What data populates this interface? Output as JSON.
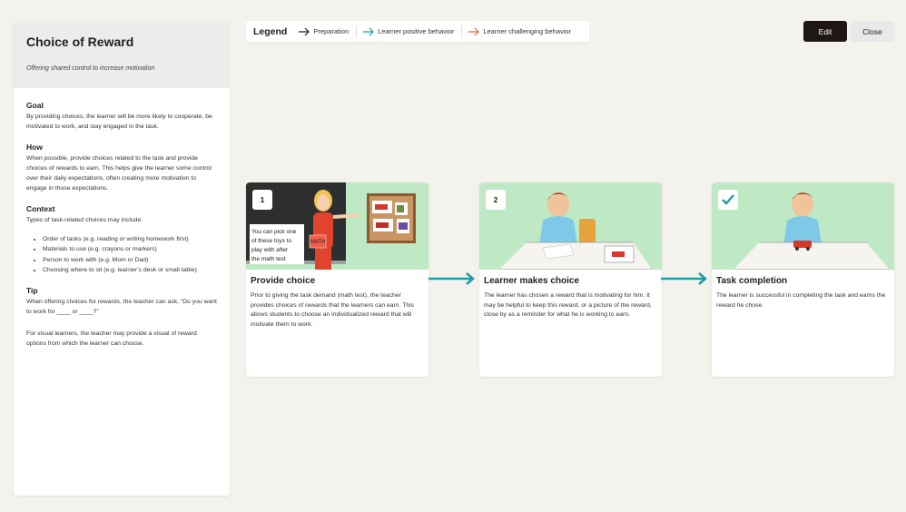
{
  "sidebar": {
    "title": "Choice of Reward",
    "subtitle": "Offering shared control to increase motivation",
    "goal": {
      "title": "Goal",
      "text": "By providing choices, the learner will be more likely to cooperate, be motivated to work, and stay engaged in the task."
    },
    "how": {
      "title": "How",
      "text": "When possible, provide choices related to the task and provide choices of rewards to earn. This helps give the learner some control over their daily expectations, often creating more motivation to engage in those expectations."
    },
    "context": {
      "title": "Context",
      "text": "Types of task-related choices may include:",
      "items": [
        "Order of tasks (e.g. reading or writing homework first)",
        "Materials to use (e.g. crayons or markers)",
        "Person to work with (e.g. Mom or Dad)",
        "Choosing where to sit (e.g. learner’s desk or small table)"
      ]
    },
    "tip": {
      "title": "Tip",
      "text": "When offering choices for rewards, the teacher can ask,  “Do you want to work for ____ or ____?”",
      "text2": "For visual learners, the teacher may provide a visual of reward options from which the learner can choose."
    }
  },
  "legend": {
    "title": "Legend",
    "items": [
      {
        "label": "Preparation",
        "color": "#222222"
      },
      {
        "label": "Learner positive behavior",
        "color": "#1a9ea3"
      },
      {
        "label": "Learner challenging behavior",
        "color": "#e0643f"
      }
    ]
  },
  "buttons": {
    "edit": "Edit",
    "close": "Close"
  },
  "cards": [
    {
      "badge": "1",
      "title": "Provide choice",
      "text": "Prior to giving the task demand (math test), the teacher provides choices of rewards that the learners can earn. This allows students to choose an individualized reward that will motivate them to work.",
      "speech": [
        "You can pick one",
        "of these toys  to",
        "play with after",
        "the math test"
      ],
      "paper_label": "MATH"
    },
    {
      "badge": "2",
      "title": "Learner makes choice",
      "text": "The learner has chosen a reward that is motivating for him. It may be helpful to keep this reward, or a picture of the reward, close by as a reminder for what he is working to earn."
    },
    {
      "badge": "check",
      "title": "Task completion",
      "text": "The learner is successful in completing the task and earns the reward he chose."
    }
  ],
  "colors": {
    "illustration_bg": "#bfe8c4",
    "arrow": "#1a9ea3",
    "edit_bg": "#1f1715"
  }
}
